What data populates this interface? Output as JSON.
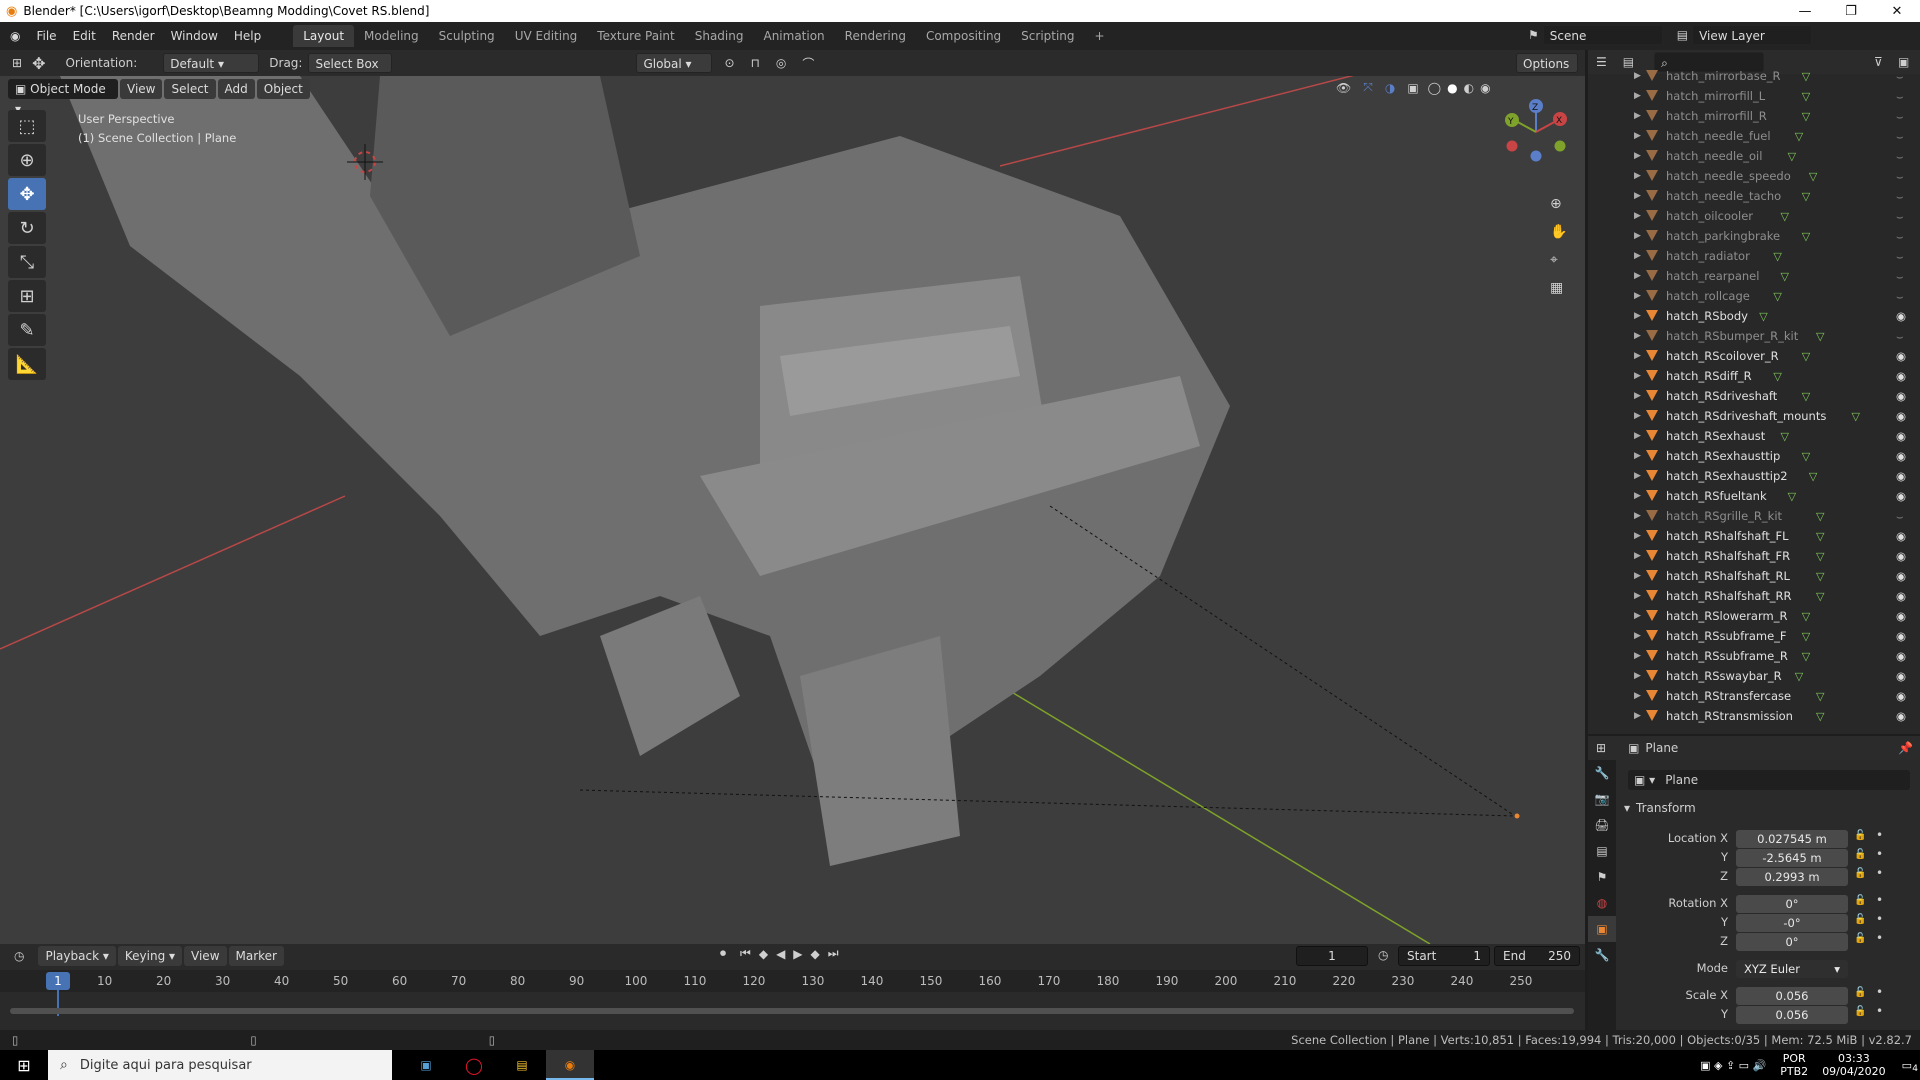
{
  "window": {
    "title": "Blender* [C:\\Users\\igorf\\Desktop\\Beamng Modding\\Covet RS.blend]"
  },
  "menubar": {
    "items": [
      "File",
      "Edit",
      "Render",
      "Window",
      "Help"
    ],
    "workspaces": [
      "Layout",
      "Modeling",
      "Sculpting",
      "UV Editing",
      "Texture Paint",
      "Shading",
      "Animation",
      "Rendering",
      "Compositing",
      "Scripting"
    ],
    "active_workspace": "Layout",
    "scene": "Scene",
    "view_layer": "View Layer"
  },
  "viewport_header": {
    "orientation_label": "Orientation:",
    "orientation_value": "Default",
    "drag_label": "Drag:",
    "drag_value": "Select Box",
    "transform_space": "Global",
    "options": "Options"
  },
  "viewport": {
    "mode": "Object Mode",
    "menus": [
      "View",
      "Select",
      "Add",
      "Object"
    ],
    "perspective": "User Perspective",
    "collection_info": "(1) Scene Collection | Plane",
    "gizmo": {
      "x": "X",
      "y": "Y",
      "z": "Z"
    }
  },
  "outliner": {
    "items": [
      {
        "name": "hatch_mirrorbase_R",
        "visible": false
      },
      {
        "name": "hatch_mirrorfill_L",
        "visible": false
      },
      {
        "name": "hatch_mirrorfill_R",
        "visible": false
      },
      {
        "name": "hatch_needle_fuel",
        "visible": false
      },
      {
        "name": "hatch_needle_oil",
        "visible": false
      },
      {
        "name": "hatch_needle_speedo",
        "visible": false
      },
      {
        "name": "hatch_needle_tacho",
        "visible": false
      },
      {
        "name": "hatch_oilcooler",
        "visible": false
      },
      {
        "name": "hatch_parkingbrake",
        "visible": false
      },
      {
        "name": "hatch_radiator",
        "visible": false
      },
      {
        "name": "hatch_rearpanel",
        "visible": false
      },
      {
        "name": "hatch_rollcage",
        "visible": false
      },
      {
        "name": "hatch_RSbody",
        "visible": true
      },
      {
        "name": "hatch_RSbumper_R_kit",
        "visible": false
      },
      {
        "name": "hatch_RScoilover_R",
        "visible": true
      },
      {
        "name": "hatch_RSdiff_R",
        "visible": true
      },
      {
        "name": "hatch_RSdriveshaft",
        "visible": true
      },
      {
        "name": "hatch_RSdriveshaft_mounts",
        "visible": true
      },
      {
        "name": "hatch_RSexhaust",
        "visible": true
      },
      {
        "name": "hatch_RSexhausttip",
        "visible": true
      },
      {
        "name": "hatch_RSexhausttip2",
        "visible": true
      },
      {
        "name": "hatch_RSfueltank",
        "visible": true
      },
      {
        "name": "hatch_RSgrille_R_kit",
        "visible": false
      },
      {
        "name": "hatch_RShalfshaft_FL",
        "visible": true
      },
      {
        "name": "hatch_RShalfshaft_FR",
        "visible": true
      },
      {
        "name": "hatch_RShalfshaft_RL",
        "visible": true
      },
      {
        "name": "hatch_RShalfshaft_RR",
        "visible": true
      },
      {
        "name": "hatch_RSlowerarm_R",
        "visible": true
      },
      {
        "name": "hatch_RSsubframe_F",
        "visible": true
      },
      {
        "name": "hatch_RSsubframe_R",
        "visible": true
      },
      {
        "name": "hatch_RSswaybar_R",
        "visible": true
      },
      {
        "name": "hatch_RStransfercase",
        "visible": true
      },
      {
        "name": "hatch_RStransmission",
        "visible": true
      }
    ]
  },
  "properties": {
    "object_name": "Plane",
    "datablock_name": "Plane",
    "panel": "Transform",
    "location": {
      "label": "Location X",
      "x": "0.027545 m",
      "y": "-2.5645 m",
      "z": "0.2993 m"
    },
    "rotation": {
      "label": "Rotation X",
      "x": "0°",
      "y": "-0°",
      "z": "0°"
    },
    "mode_label": "Mode",
    "mode_value": "XYZ Euler",
    "scale": {
      "label": "Scale X",
      "x": "0.056",
      "y": "0.056"
    },
    "axis_y": "Y",
    "axis_z": "Z"
  },
  "timeline": {
    "menus": [
      "Playback",
      "Keying",
      "View",
      "Marker"
    ],
    "current_frame": "1",
    "start_label": "Start",
    "start": "1",
    "end_label": "End",
    "end": "250",
    "ticks": [
      "10",
      "20",
      "30",
      "40",
      "50",
      "60",
      "70",
      "80",
      "90",
      "100",
      "110",
      "120",
      "130",
      "140",
      "150",
      "160",
      "170",
      "180",
      "190",
      "200",
      "210",
      "220",
      "230",
      "240",
      "250"
    ],
    "playhead": "1"
  },
  "statusbar": {
    "text": "Scene Collection | Plane | Verts:10,851 | Faces:19,994 | Tris:20,000 | Objects:0/35 | Mem: 72.5 MiB | v2.82.7"
  },
  "taskbar": {
    "search_placeholder": "Digite aqui para pesquisar",
    "lang1": "POR",
    "lang2": "PTB2",
    "time": "03:33",
    "date": "09/04/2020",
    "notif_count": "4"
  },
  "colors": {
    "accent": "#4772b3",
    "object_orange": "#e98735",
    "mesh_green": "#7fc95a",
    "axis_red": "#c94545",
    "axis_green": "#7ea22a"
  }
}
